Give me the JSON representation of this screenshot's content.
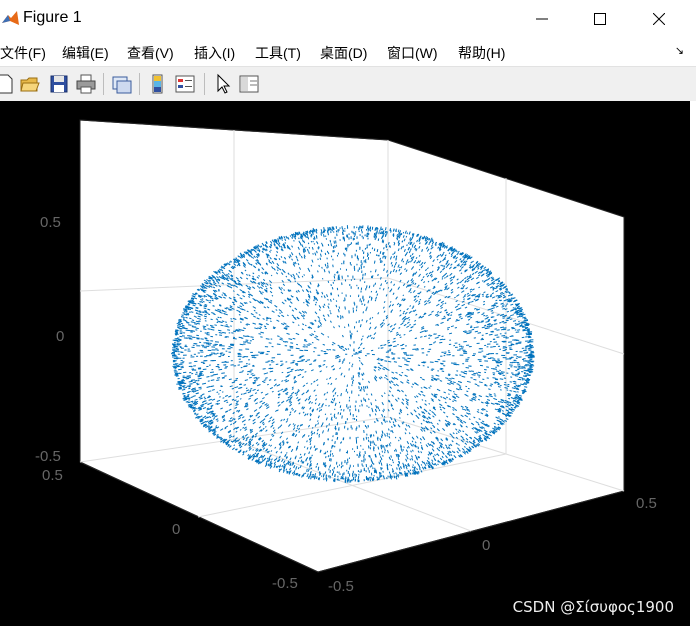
{
  "window": {
    "title": "Figure 1",
    "icon": "matlab-logo-icon",
    "controls": [
      "minimize-icon",
      "maximize-icon",
      "close-icon"
    ]
  },
  "menu": {
    "items": [
      "文件(F)",
      "编辑(E)",
      "查看(V)",
      "插入(I)",
      "工具(T)",
      "桌面(D)",
      "窗口(W)",
      "帮助(H)"
    ],
    "overflow_icon": "dock-arrow-icon"
  },
  "toolbar": {
    "buttons": [
      "new-figure-icon",
      "open-folder-icon",
      "save-icon",
      "print-icon",
      "link-plot-icon",
      "colorbar-icon",
      "legend-icon",
      "pointer-icon",
      "property-editor-icon"
    ]
  },
  "axes": {
    "z_ticks": [
      "0.5",
      "0",
      "-0.5"
    ],
    "x_ticks": [
      "0.5",
      "0",
      "-0.5"
    ],
    "y_ticks": [
      "-0.5",
      "0",
      "0.5"
    ],
    "background": "#ffffff",
    "figure_background": "#000000",
    "grid": true
  },
  "plot": {
    "type": "3d-scatter",
    "shape": "sphere",
    "color": "#0072BD"
  },
  "watermark": "CSDN @Σίσυφος1900"
}
